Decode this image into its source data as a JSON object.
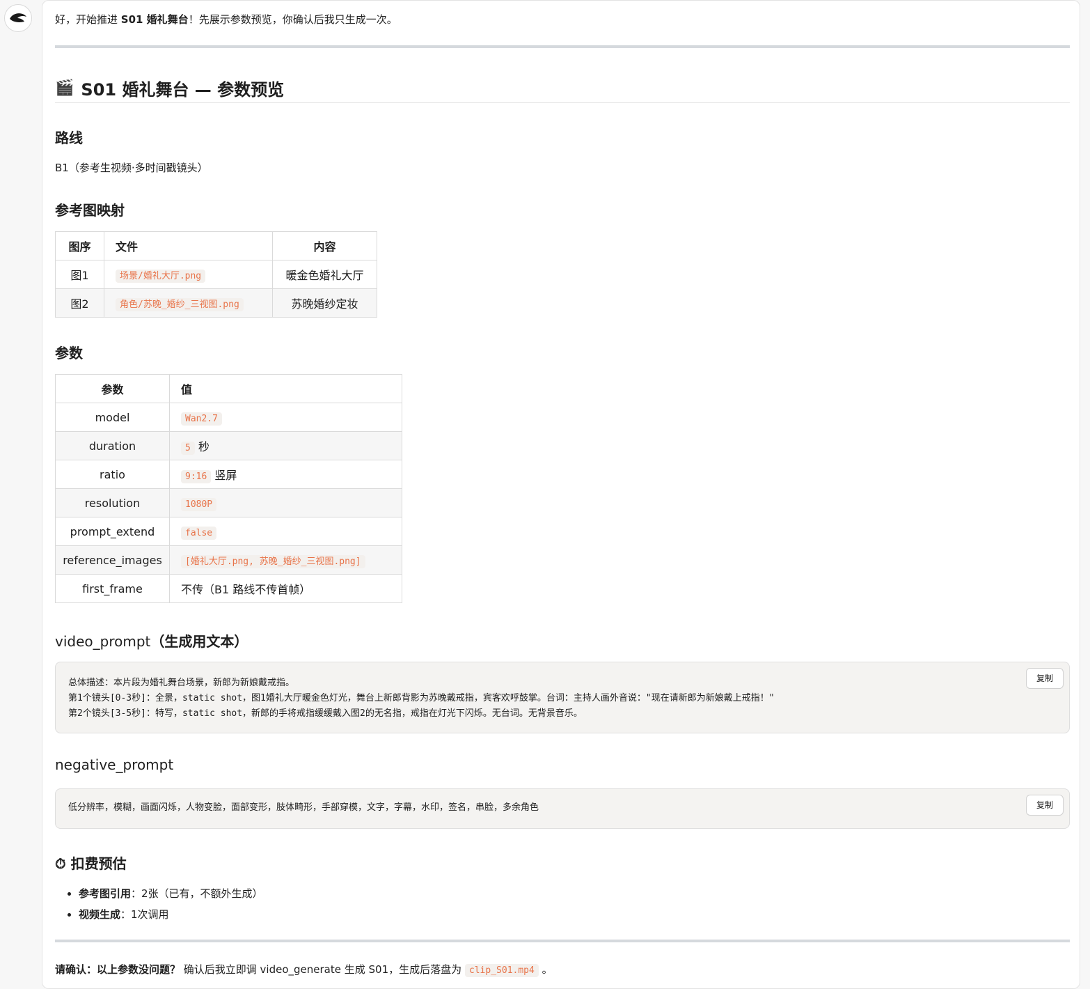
{
  "intro": {
    "prefix": "好，开始推进 ",
    "bold1": "S01 婚礼舞台",
    "suffix": "！先展示参数预览，你确认后我只生成一次。"
  },
  "title": {
    "icon": "🎬",
    "text": "S01 婚礼舞台 — 参数预览"
  },
  "route": {
    "heading": "路线",
    "text": "B1（参考生视频·多时间戳镜头）"
  },
  "refmap": {
    "heading": "参考图映射",
    "columns": [
      "图序",
      "文件",
      "内容"
    ],
    "rows": [
      {
        "idx": "图1",
        "file": "场景/婚礼大厅.png",
        "content": "暖金色婚礼大厅"
      },
      {
        "idx": "图2",
        "file": "角色/苏晚_婚纱_三视图.png",
        "content": "苏晚婚纱定妆"
      }
    ]
  },
  "params": {
    "heading": "参数",
    "columns": [
      "参数",
      "值"
    ],
    "rows": [
      {
        "name": "model",
        "code": "Wan2.7",
        "extra": ""
      },
      {
        "name": "duration",
        "code": "5",
        "extra": "秒"
      },
      {
        "name": "ratio",
        "code": "9:16",
        "extra": "竖屏"
      },
      {
        "name": "resolution",
        "code": "1080P",
        "extra": ""
      },
      {
        "name": "prompt_extend",
        "code": "false",
        "extra": ""
      },
      {
        "name": "reference_images",
        "code": "[婚礼大厅.png, 苏晚_婚纱_三视图.png]",
        "extra": ""
      },
      {
        "name": "first_frame",
        "code": "",
        "extra": "不传（B1 路线不传首帧）"
      }
    ]
  },
  "video_prompt": {
    "heading_prefix": "video_prompt",
    "heading_suffix": "（生成用文本）",
    "lines": [
      "总体描述：本片段为婚礼舞台场景，新郎为新娘戴戒指。",
      "第1个镜头[0-3秒]：全景，static shot，图1婚礼大厅暖金色灯光，舞台上新郎背影为苏晚戴戒指，宾客欢呼鼓掌。台词：主持人画外音说：\"现在请新郎为新娘戴上戒指！\"",
      "第2个镜头[3-5秒]：特写，static shot，新郎的手将戒指缓缓戴入图2的无名指，戒指在灯光下闪烁。无台词。无背景音乐。"
    ],
    "copy": "复制"
  },
  "negative_prompt": {
    "heading": "negative_prompt",
    "text": "低分辨率，模糊，画面闪烁，人物变脸，面部变形，肢体畸形，手部穿模，文字，字幕，水印，签名，串脸，多余角色",
    "copy": "复制"
  },
  "cost": {
    "heading": "⏱ 扣费预估",
    "items": [
      {
        "label": "参考图引用",
        "text": "：2张（已有，不额外生成）"
      },
      {
        "label": "视频生成",
        "text": "：1次调用"
      }
    ]
  },
  "confirm": {
    "bold": "请确认：以上参数没问题？",
    "text": " 确认后我立即调 video_generate 生成 S01，生成后落盘为 ",
    "code": "clip_S01.mp4",
    "end": " 。"
  }
}
